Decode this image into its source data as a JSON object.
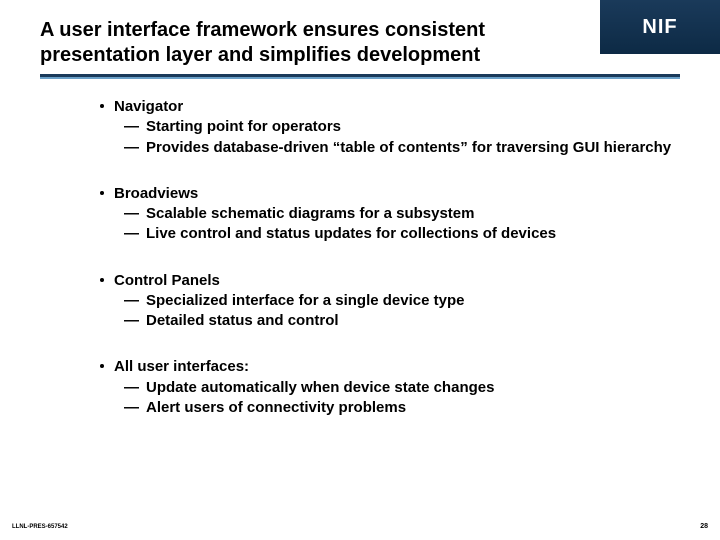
{
  "header": {
    "title": "A user interface framework ensures consistent presentation layer and simplifies development",
    "logo": "NIF"
  },
  "body": [
    {
      "label": "Navigator",
      "subs": [
        "Starting point for operators",
        "Provides database-driven “table of contents” for traversing GUI hierarchy"
      ]
    },
    {
      "label": "Broadviews",
      "subs": [
        "Scalable schematic diagrams for a subsystem",
        "Live control and status updates for collections of devices"
      ]
    },
    {
      "label": "Control Panels",
      "subs": [
        "Specialized interface for a single device type",
        "Detailed status and control"
      ]
    },
    {
      "label": "All user interfaces:",
      "subs": [
        "Update automatically when device state changes",
        "Alert users of connectivity problems"
      ]
    }
  ],
  "footer": {
    "doc_id": "LLNL-PRES-657542",
    "page": "28"
  }
}
